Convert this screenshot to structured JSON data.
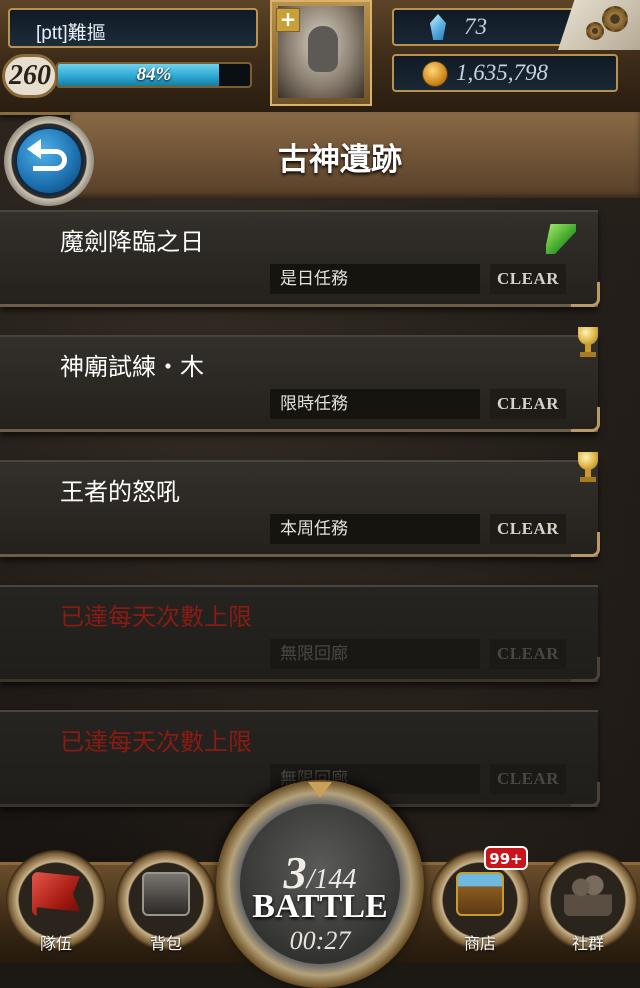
{
  "player": {
    "name": "[ptt]難摳",
    "level": "260",
    "exp_percent_text": "84%",
    "exp_fraction": 0.84,
    "gems": "73",
    "coins": "1,635,798"
  },
  "header": {
    "title": "古神遺跡"
  },
  "missions": [
    {
      "title": "魔劍降臨之日",
      "type": "是日任務",
      "status": "CLEAR",
      "locked": false,
      "icon": "sword-icon"
    },
    {
      "title": "神廟試練・木",
      "type": "限時任務",
      "status": "CLEAR",
      "locked": false,
      "icon": "trophy-icon"
    },
    {
      "title": "王者的怒吼",
      "type": "本周任務",
      "status": "CLEAR",
      "locked": false,
      "icon": "trophy-icon"
    },
    {
      "title": "已達每天次數上限",
      "type": "無限回廊",
      "status": "CLEAR",
      "locked": true,
      "icon": ""
    },
    {
      "title": "已達每天次數上限",
      "type": "無限回廊",
      "status": "CLEAR",
      "locked": true,
      "icon": ""
    }
  ],
  "battle": {
    "stamina": "3",
    "stamina_max": "/144",
    "label": "BATTLE",
    "timer": "00:27"
  },
  "nav": {
    "team": "隊伍",
    "bag": "背包",
    "shop": "商店",
    "shop_badge": "99+",
    "social": "社群"
  },
  "colors": {
    "locked_title": "#8a1a14",
    "exp_bar": "#2aa6cf",
    "badge": "#c8141a"
  }
}
